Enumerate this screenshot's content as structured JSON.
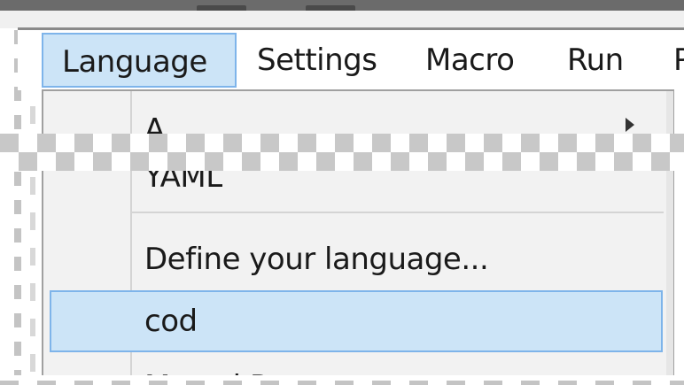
{
  "menubar": {
    "items": [
      {
        "label": "Language",
        "active": true
      },
      {
        "label": "Settings",
        "active": false
      },
      {
        "label": "Macro",
        "active": false
      },
      {
        "label": "Run",
        "active": false
      },
      {
        "label": "P",
        "active": false
      }
    ]
  },
  "language_menu": {
    "items": [
      {
        "label": "A",
        "has_submenu": true
      },
      {
        "label": "YAML",
        "has_submenu": false
      },
      {
        "label": "Define your language...",
        "has_submenu": false
      },
      {
        "label": "cod",
        "highlighted": true
      },
      {
        "label": "Mostel R",
        "has_submenu": false
      }
    ]
  },
  "colors": {
    "highlight_fill": "#cce4f7",
    "highlight_border": "#7eb4ea",
    "menu_background": "#f2f2f2"
  }
}
